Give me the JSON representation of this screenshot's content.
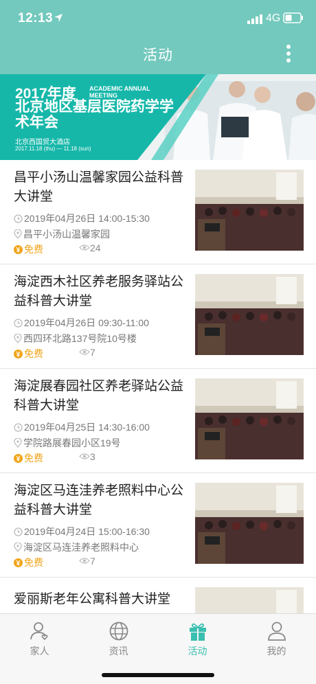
{
  "status_bar": {
    "time": "12:13",
    "network": "4G"
  },
  "header": {
    "title": "活动"
  },
  "banner": {
    "year_text": "2017年度",
    "english_text": "ACADEMIC ANNUAL MEETING",
    "title": "北京地区基层医院药学学术年会",
    "venue": "北京西国贸大酒店",
    "dates": "2017.11.18 (thu) — 11.18 (sun)"
  },
  "events": [
    {
      "title": "昌平小汤山温馨家园公益科普大讲堂",
      "date": "2019年04月26日 14:00-15:30",
      "address": "昌平小汤山温馨家园",
      "price": "免费",
      "views": "24"
    },
    {
      "title": "海淀西木社区养老服务驿站公益科普大讲堂",
      "date": "2019年04月26日 09:30-11:00",
      "address": "西四环北路137号院10号楼",
      "price": "免费",
      "views": "7"
    },
    {
      "title": "海淀展春园社区养老驿站公益科普大讲堂",
      "date": "2019年04月25日 14:30-16:00",
      "address": "学院路展春园小区19号",
      "price": "免费",
      "views": "3"
    },
    {
      "title": "海淀区马连洼养老照料中心公益科普大讲堂",
      "date": "2019年04月24日 15:00-16:30",
      "address": "海淀区马连洼养老照料中心",
      "price": "免费",
      "views": "7"
    },
    {
      "title": "爱丽斯老年公寓科普大讲堂"
    }
  ],
  "tabs": [
    {
      "label": "家人",
      "icon": "family-icon"
    },
    {
      "label": "资讯",
      "icon": "globe-icon"
    },
    {
      "label": "活动",
      "icon": "gift-icon",
      "active": true
    },
    {
      "label": "我的",
      "icon": "person-icon"
    }
  ],
  "colors": {
    "header": "#73c9bd",
    "accent": "#3bbfb0",
    "price": "#f0a51a"
  }
}
